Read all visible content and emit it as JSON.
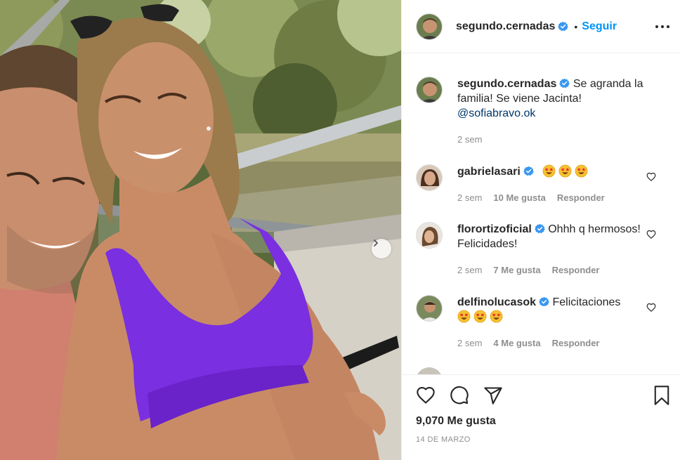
{
  "post": {
    "author": "segundo.cernadas",
    "follow_label": "Seguir",
    "dot": "•",
    "caption_text": "Se agranda la familia! Se viene Jacinta!",
    "caption_mention": "@sofiabravo.ok",
    "caption_time": "2 sem",
    "likes_label": "9,070 Me gusta",
    "date_label": "14 DE MARZO"
  },
  "comments": [
    {
      "username": "gabrielasari",
      "text": "",
      "emojis": 3,
      "time": "2 sem",
      "likes": "10 Me gusta",
      "reply": "Responder"
    },
    {
      "username": "florortizoficial",
      "text": "Ohhh q hermosos! Felicidades!",
      "emojis": 0,
      "time": "2 sem",
      "likes": "7 Me gusta",
      "reply": "Responder"
    },
    {
      "username": "delfinolucasok",
      "text": "Felicitaciones",
      "emojis": 3,
      "time": "2 sem",
      "likes": "4 Me gusta",
      "reply": "Responder"
    }
  ],
  "colors": {
    "accent": "#0095f6",
    "verified": "#3897f0",
    "mention": "#00376b",
    "muted": "#8e8e8e",
    "bikini": "#7a2fe0"
  },
  "icons": [
    "verified-badge-icon",
    "more-options-icon",
    "heart-icon",
    "comment-icon",
    "share-icon",
    "bookmark-icon",
    "chevron-right-icon",
    "star-struck-emoji"
  ]
}
